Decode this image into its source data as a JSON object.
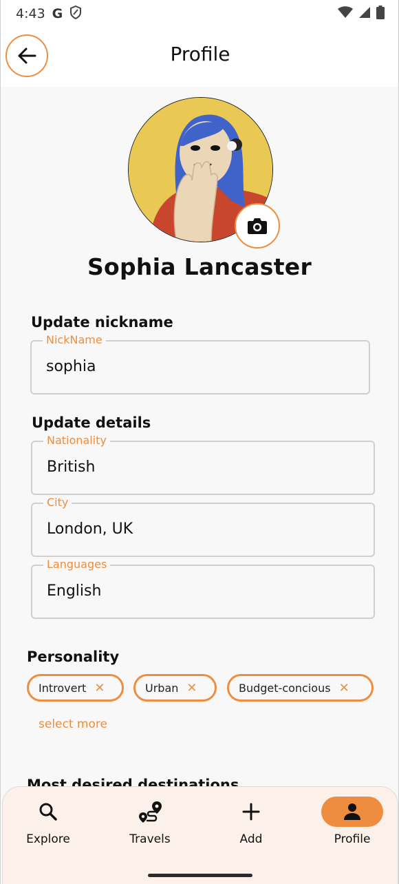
{
  "status_bar": {
    "time": "4:43",
    "google_glyph": "G",
    "icons": [
      "shield-icon",
      "wifi-icon",
      "signal-icon",
      "battery-icon"
    ]
  },
  "header": {
    "title": "Profile"
  },
  "profile": {
    "name": "Sophia Lancaster"
  },
  "nickname_section": {
    "title": "Update nickname",
    "field": {
      "label": "NickName",
      "value": "sophia"
    }
  },
  "details_section": {
    "title": "Update details",
    "fields": [
      {
        "label": "Nationality",
        "value": "British"
      },
      {
        "label": "City",
        "value": "London, UK"
      },
      {
        "label": "Languages",
        "value": "English"
      }
    ]
  },
  "personality": {
    "title": "Personality",
    "chips": [
      {
        "label": "Introvert",
        "remove": "✕"
      },
      {
        "label": "Urban",
        "remove": "✕"
      },
      {
        "label": "Budget-concious",
        "remove": "✕"
      }
    ],
    "select_more": "select more"
  },
  "destinations": {
    "title": "Most desired destinations"
  },
  "bottom_nav": {
    "items": [
      {
        "label": "Explore",
        "icon": "search-icon",
        "active": false
      },
      {
        "label": "Travels",
        "icon": "route-icon",
        "active": false
      },
      {
        "label": "Add",
        "icon": "plus-icon",
        "active": false
      },
      {
        "label": "Profile",
        "icon": "person-icon",
        "active": true
      }
    ]
  },
  "colors": {
    "accent": "#ee8d3f",
    "background": "#f8f8f8",
    "nav_background": "#fcf1ea"
  }
}
